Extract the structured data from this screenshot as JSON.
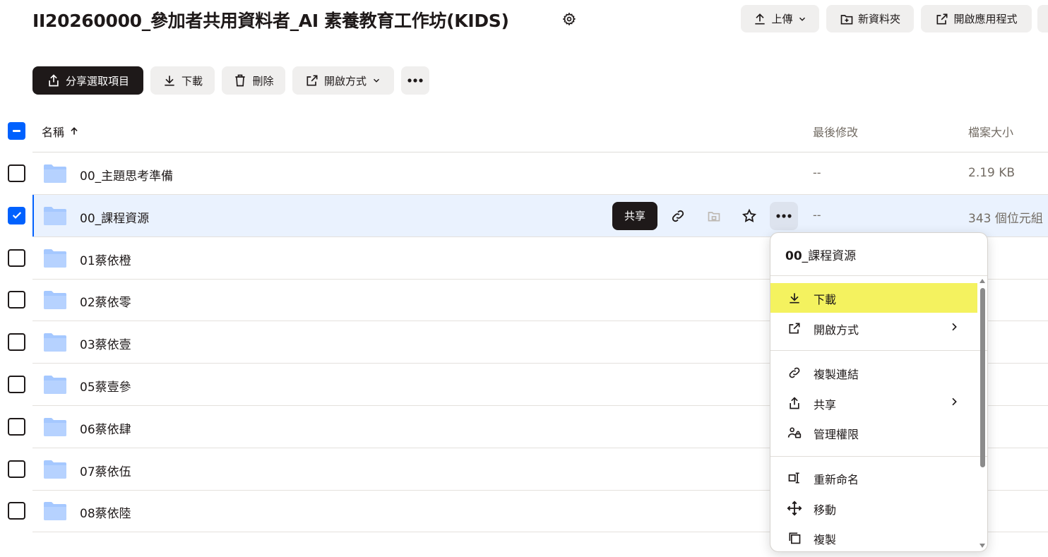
{
  "header": {
    "title": "II20260000_參加者共用資料者_AI 素養教育工作坊(KIDS)",
    "settings_icon": "gear-icon",
    "upload_label": "上傳",
    "new_folder_label": "新資料夾",
    "open_app_label": "開啟應用程式"
  },
  "toolbar": {
    "share_selected_label": "分享選取項目",
    "download_label": "下載",
    "delete_label": "刪除",
    "open_with_label": "開啟方式"
  },
  "table": {
    "col_name": "名稱",
    "col_modified": "最後修改",
    "col_size": "檔案大小",
    "rows": [
      {
        "name": "00_主題思考準備",
        "modified": "--",
        "size": "2.19 KB"
      },
      {
        "name": "00_課程資源",
        "modified": "--",
        "size": "343 個位元組"
      },
      {
        "name": "01蔡依橙",
        "modified": "",
        "size": ""
      },
      {
        "name": "02蔡依零",
        "modified": "",
        "size": ""
      },
      {
        "name": "03蔡依壹",
        "modified": "",
        "size": ""
      },
      {
        "name": "05蔡壹參",
        "modified": "",
        "size": ""
      },
      {
        "name": "06蔡依肆",
        "modified": "",
        "size": ""
      },
      {
        "name": "07蔡依伍",
        "modified": "",
        "size": ""
      },
      {
        "name": "08蔡依陸",
        "modified": "",
        "size": ""
      }
    ]
  },
  "row_actions": {
    "share_label": "共享"
  },
  "context_menu": {
    "title_bold": "00",
    "title_rest": "_課程資源",
    "items": {
      "download": "下載",
      "open_with": "開啟方式",
      "copy_link": "複製連結",
      "share": "共享",
      "manage_permissions": "管理權限",
      "rename": "重新命名",
      "move": "移動",
      "copy": "複製"
    }
  },
  "colors": {
    "accent": "#0061fe",
    "highlight": "#f4f25f",
    "dark_button": "#1e1919",
    "folder": "#a5c8ff"
  }
}
